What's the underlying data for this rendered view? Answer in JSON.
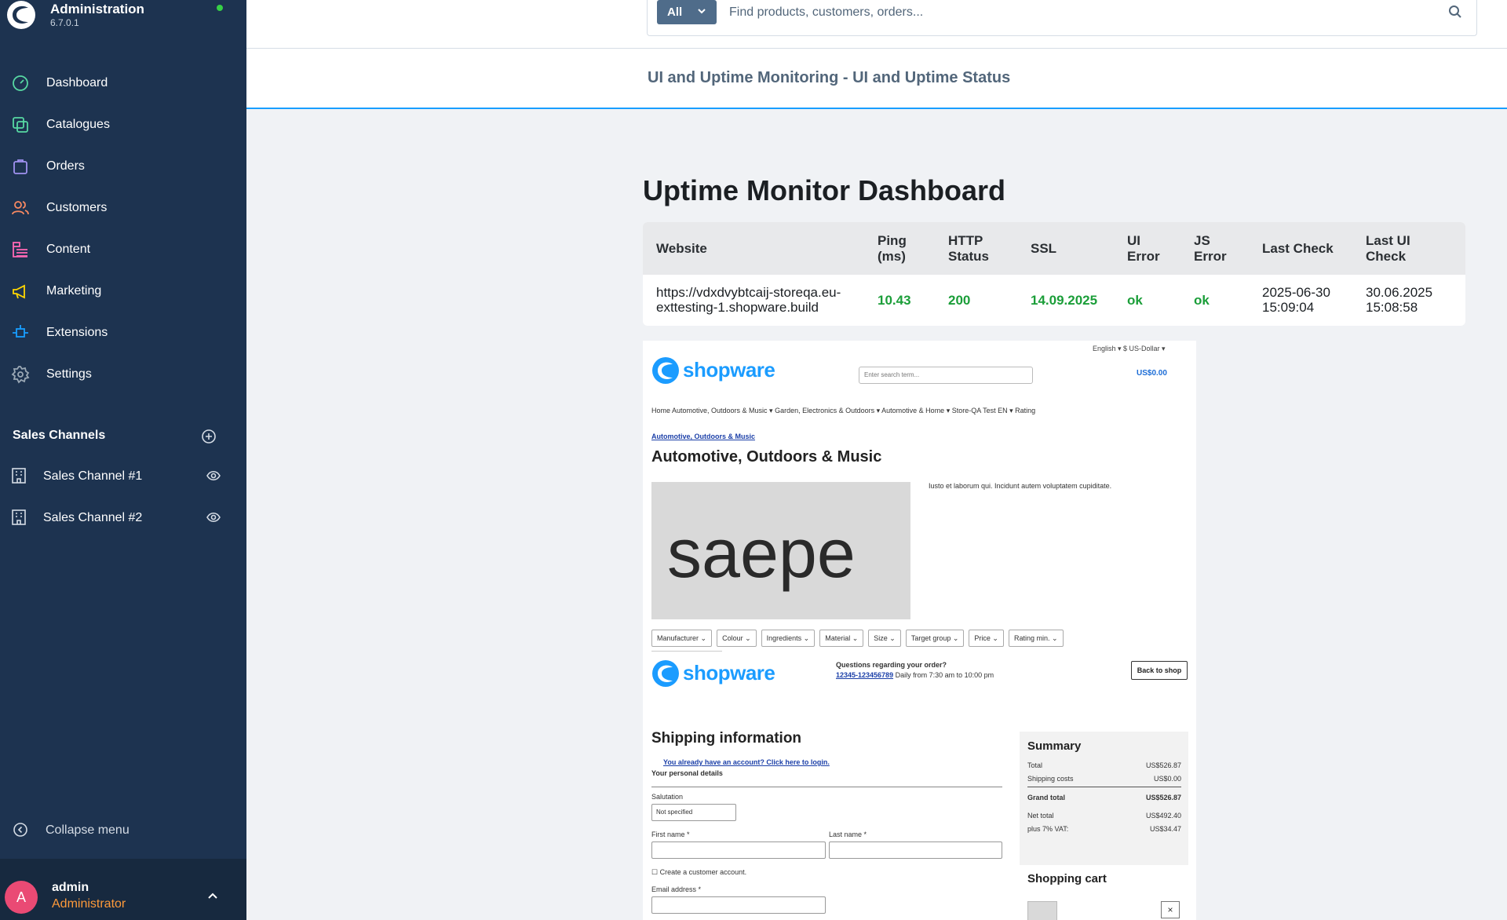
{
  "sidebar": {
    "app_title": "Administration",
    "version": "6.7.0.1",
    "nav": [
      {
        "label": "Dashboard",
        "icon": "dashboard-icon",
        "color": "#57d9a3"
      },
      {
        "label": "Catalogues",
        "icon": "catalogue-icon",
        "color": "#57d9a3"
      },
      {
        "label": "Orders",
        "icon": "orders-icon",
        "color": "#a092f0"
      },
      {
        "label": "Customers",
        "icon": "customers-icon",
        "color": "#f88962"
      },
      {
        "label": "Content",
        "icon": "content-icon",
        "color": "#ff68b4"
      },
      {
        "label": "Marketing",
        "icon": "marketing-icon",
        "color": "#ffd700"
      },
      {
        "label": "Extensions",
        "icon": "extensions-icon",
        "color": "#189eff"
      },
      {
        "label": "Settings",
        "icon": "settings-icon",
        "color": "#9aa8b5"
      }
    ],
    "sales_channels_title": "Sales Channels",
    "sales_channels": [
      {
        "label": "Sales Channel #1"
      },
      {
        "label": "Sales Channel #2"
      }
    ],
    "collapse_label": "Collapse menu",
    "user": {
      "initial": "A",
      "name": "admin",
      "role": "Administrator"
    }
  },
  "search": {
    "type_label": "All",
    "placeholder": "Find products, customers, orders..."
  },
  "page": {
    "title": "UI and Uptime Monitoring - UI and Uptime Status"
  },
  "dashboard": {
    "title": "Uptime Monitor Dashboard",
    "columns": {
      "website": "Website",
      "ping": [
        "Ping",
        "(ms)"
      ],
      "http": [
        "HTTP",
        "Status"
      ],
      "ssl": "SSL",
      "ui_error": [
        "UI",
        "Error"
      ],
      "js_error": [
        "JS",
        "Error"
      ],
      "last_check": "Last Check",
      "last_ui_check": [
        "Last UI",
        "Check"
      ]
    },
    "row": {
      "website": [
        "https://vdxdvybtcaij-storeqa.eu-",
        "exttesting-1.shopware.build"
      ],
      "ping": "10.43",
      "http": "200",
      "ssl": "14.09.2025",
      "ui_error": "ok",
      "js_error": "ok",
      "last_check": [
        "2025-06-30",
        "15:09:04"
      ],
      "last_ui_check": [
        "30.06.2025",
        "15:08:58"
      ]
    }
  },
  "screenshot": {
    "lang": "English ▾   $ US-Dollar ▾",
    "logo_text": "shopware",
    "search_placeholder": "Enter search term...",
    "cart_total": "US$0.00",
    "nav": "Home   Automotive, Outdoors & Music ▾   Garden, Electronics & Outdoors ▾   Automotive & Home ▾   Store-QA Test EN ▾   Rating",
    "breadcrumb": "Automotive, Outdoors & Music",
    "category_title": "Automotive, Outdoors & Music",
    "image_word": "saepe",
    "description": "Iusto et laborum qui. Incidunt autem voluptatem cupiditate.",
    "filters": [
      "Manufacturer ⌄",
      "Colour ⌄",
      "Ingredients ⌄",
      "Material ⌄",
      "Size ⌄",
      "Target group ⌄",
      "Price ⌄",
      "Rating min. ⌄"
    ],
    "contact_title": "Questions regarding your order?",
    "contact_phone": "12345-123456789",
    "contact_hours": "Daily from 7:30 am to 10:00 pm",
    "back_to_shop": "Back to shop",
    "shipping_title": "Shipping information",
    "login_link": "You already have an account? Click here to login.",
    "personal_details": "Your personal details",
    "salutation_label": "Salutation",
    "salutation_value": "Not specified",
    "first_name": "First name *",
    "last_name": "Last name *",
    "create_account": "Create a customer account.",
    "email": "Email address *",
    "summary": {
      "title": "Summary",
      "total_label": "Total",
      "total": "US$526.87",
      "shipping_label": "Shipping costs",
      "shipping": "US$0.00",
      "grand_label": "Grand total",
      "grand": "US$526.87",
      "net_label": "Net total",
      "net": "US$492.40",
      "vat_label": "plus 7% VAT:",
      "vat": "US$34.47"
    },
    "cart_title": "Shopping cart"
  }
}
